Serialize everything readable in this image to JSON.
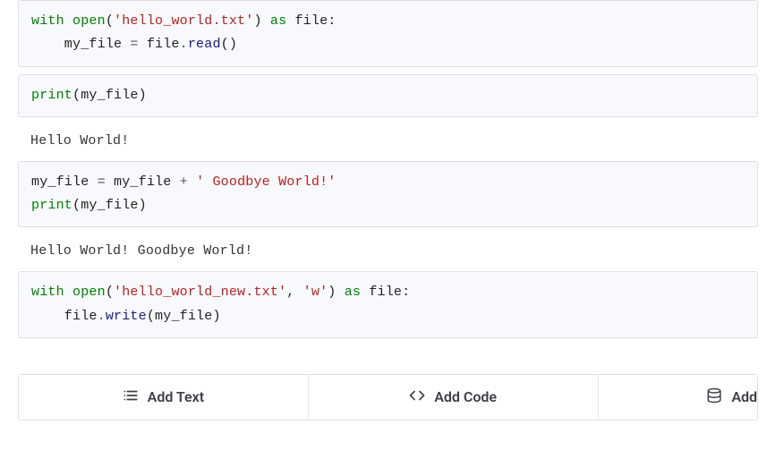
{
  "cells": [
    {
      "type": "code",
      "tokens": [
        [
          "kw",
          "with"
        ],
        [
          "text",
          " "
        ],
        [
          "builtin",
          "open"
        ],
        [
          "text",
          "("
        ],
        [
          "str",
          "'hello_world.txt'"
        ],
        [
          "text",
          ") "
        ],
        [
          "kw",
          "as"
        ],
        [
          "text",
          " file:"
        ],
        [
          "nl",
          ""
        ],
        [
          "text",
          "    my_file "
        ],
        [
          "op",
          "="
        ],
        [
          "text",
          " file"
        ],
        [
          "op",
          "."
        ],
        [
          "func",
          "read"
        ],
        [
          "text",
          "()"
        ]
      ]
    },
    {
      "type": "code",
      "tokens": [
        [
          "builtin",
          "print"
        ],
        [
          "text",
          "(my_file)"
        ]
      ]
    },
    {
      "type": "output",
      "text": "Hello World!"
    },
    {
      "type": "code",
      "tokens": [
        [
          "text",
          "my_file "
        ],
        [
          "op",
          "="
        ],
        [
          "text",
          " my_file "
        ],
        [
          "op",
          "+"
        ],
        [
          "text",
          " "
        ],
        [
          "str",
          "' Goodbye World!'"
        ],
        [
          "nl",
          ""
        ],
        [
          "builtin",
          "print"
        ],
        [
          "text",
          "(my_file)"
        ]
      ]
    },
    {
      "type": "output",
      "text": "Hello World! Goodbye World!"
    },
    {
      "type": "code",
      "tokens": [
        [
          "kw",
          "with"
        ],
        [
          "text",
          " "
        ],
        [
          "builtin",
          "open"
        ],
        [
          "text",
          "("
        ],
        [
          "str",
          "'hello_world_new.txt'"
        ],
        [
          "text",
          ", "
        ],
        [
          "str",
          "'w'"
        ],
        [
          "text",
          ") "
        ],
        [
          "kw",
          "as"
        ],
        [
          "text",
          " file:"
        ],
        [
          "nl",
          ""
        ],
        [
          "text",
          "    file"
        ],
        [
          "op",
          "."
        ],
        [
          "func",
          "write"
        ],
        [
          "text",
          "(my_file)"
        ]
      ]
    }
  ],
  "toolbar": {
    "add_text_label": "Add Text",
    "add_code_label": "Add Code",
    "add_data_label": "Add"
  }
}
